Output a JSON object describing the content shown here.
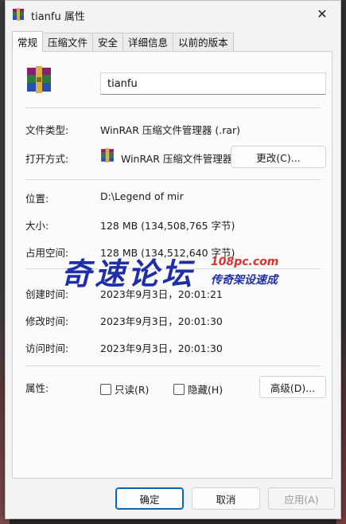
{
  "window": {
    "title": "tianfu 属性",
    "close_glyph": "✕"
  },
  "tabs": [
    {
      "label": "常规",
      "active": true
    },
    {
      "label": "压缩文件",
      "active": false
    },
    {
      "label": "安全",
      "active": false
    },
    {
      "label": "详细信息",
      "active": false
    },
    {
      "label": "以前的版本",
      "active": false
    }
  ],
  "general": {
    "file_name": "tianfu",
    "type_label": "文件类型:",
    "type_value": "WinRAR 压缩文件管理器 (.rar)",
    "open_with_label": "打开方式:",
    "open_with_value": "WinRAR 压缩文件管理器",
    "change_button": "更改(C)...",
    "location_label": "位置:",
    "location_value": "D:\\Legend of mir",
    "size_label": "大小:",
    "size_value": "128 MB (134,508,765 字节)",
    "disk_size_label": "占用空间:",
    "disk_size_value": "128 MB (134,512,640 字节)",
    "created_label": "创建时间:",
    "created_value": "2023年9月3日，20:01:21",
    "modified_label": "修改时间:",
    "modified_value": "2023年9月3日，20:01:30",
    "accessed_label": "访问时间:",
    "accessed_value": "2023年9月3日，20:01:30",
    "attributes_label": "属性:",
    "readonly_label": "只读(R)",
    "hidden_label": "隐藏(H)",
    "advanced_button": "高级(D)..."
  },
  "footer": {
    "ok": "确定",
    "cancel": "取消",
    "apply": "应用(A)"
  },
  "watermark": {
    "big": "奇速论坛",
    "site": "108pc.com",
    "slogan": "传奇架设速成"
  },
  "colors": {
    "accent": "#0067c0",
    "watermark_blue": "#1e2fa8",
    "watermark_red": "#e0312c"
  },
  "icons": [
    "winrar-archive-icon",
    "close-icon",
    "checkbox-icon"
  ]
}
